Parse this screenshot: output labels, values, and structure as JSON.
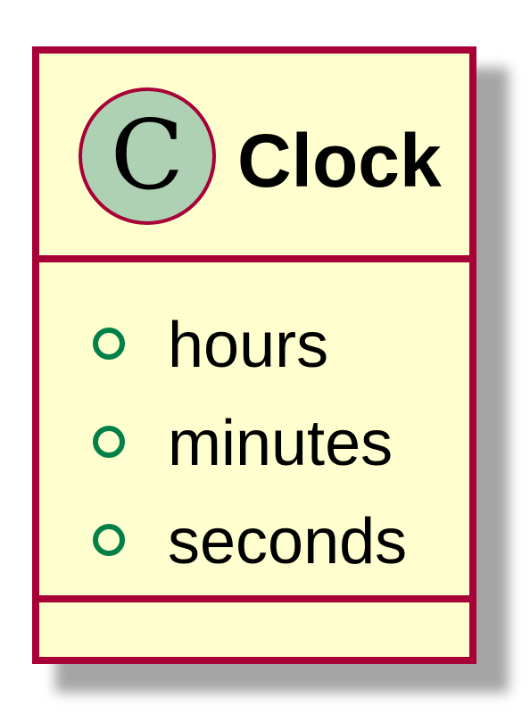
{
  "class": {
    "stereotype_letter": "C",
    "name": "Clock",
    "attributes": [
      {
        "visibility": "public",
        "name": "hours"
      },
      {
        "visibility": "public",
        "name": "minutes"
      },
      {
        "visibility": "public",
        "name": "seconds"
      }
    ],
    "methods": []
  },
  "colors": {
    "class_background": "#fefece",
    "border": "#a80036",
    "stereotype_circle": "#add1b2",
    "visibility_public": "#038048",
    "shadow": "#a5a5a5"
  },
  "icons": {
    "class_stereotype": "class-stereotype-circle-icon",
    "public_visibility": "public-visibility-circle-icon"
  }
}
